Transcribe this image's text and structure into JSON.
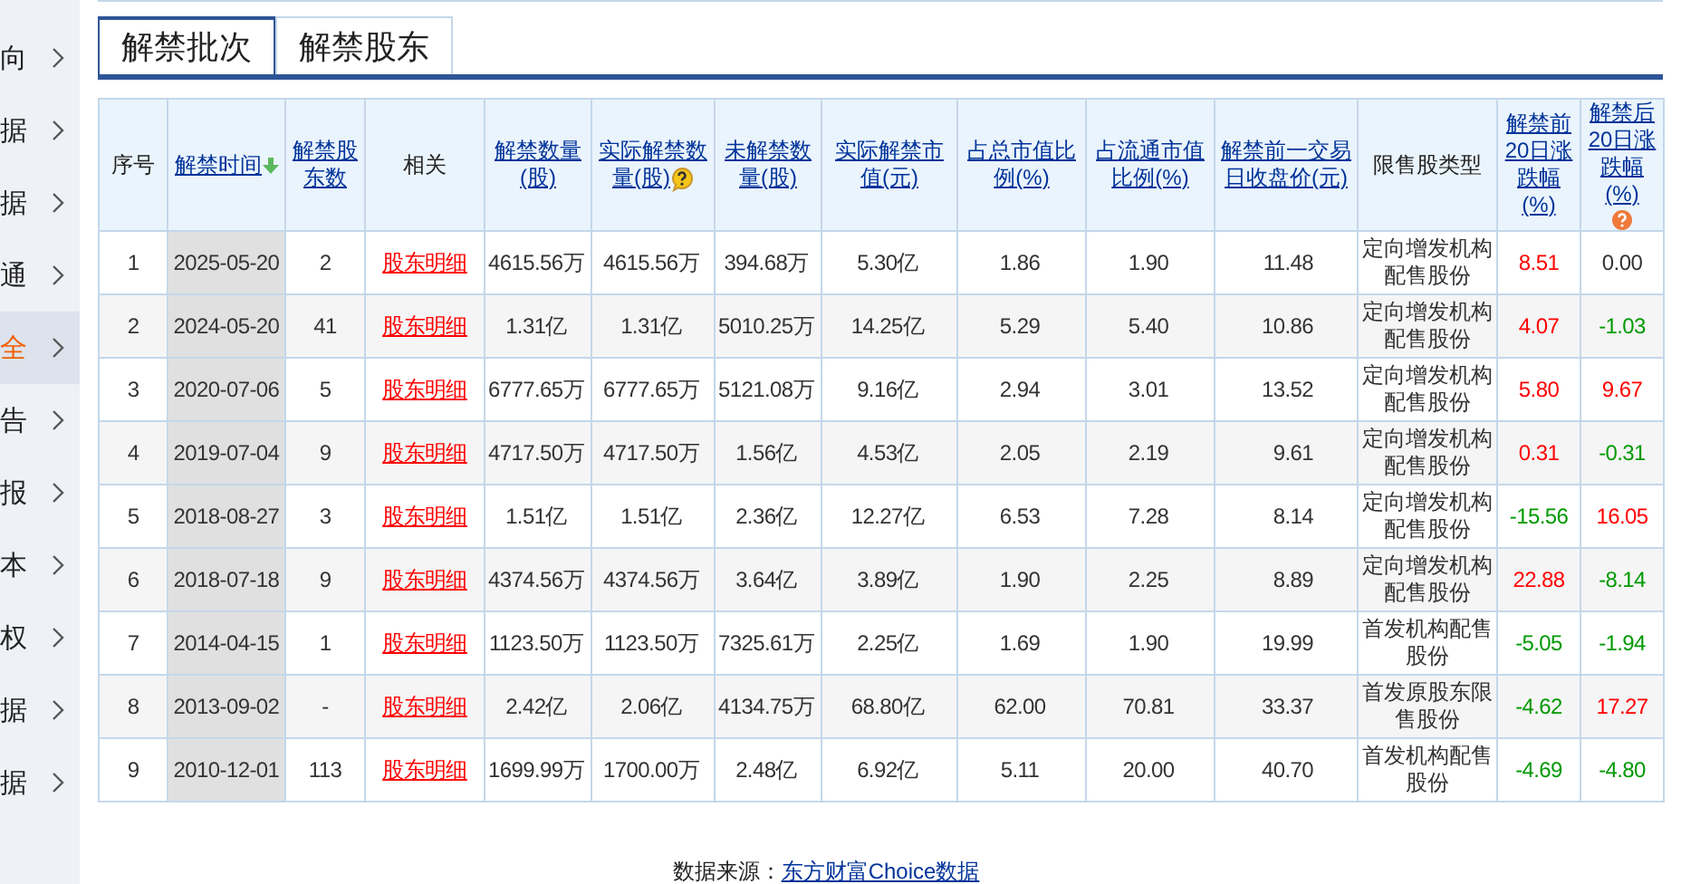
{
  "sidebar": {
    "items": [
      {
        "label": "向",
        "selected": false
      },
      {
        "label": "据",
        "selected": false
      },
      {
        "label": "据",
        "selected": false
      },
      {
        "label": "通",
        "selected": false
      },
      {
        "label": "全",
        "selected": true
      },
      {
        "label": "告",
        "selected": false
      },
      {
        "label": "报",
        "selected": false
      },
      {
        "label": "本",
        "selected": false
      },
      {
        "label": "权",
        "selected": false
      },
      {
        "label": "据",
        "selected": false
      },
      {
        "label": "据",
        "selected": false
      }
    ]
  },
  "tabs": [
    {
      "label": "解禁批次",
      "selected": true
    },
    {
      "label": "解禁股东",
      "selected": false
    }
  ],
  "table": {
    "columns": [
      {
        "label": "序号",
        "kind": "plain"
      },
      {
        "label": "解禁时间",
        "kind": "sorted"
      },
      {
        "label": "解禁股东数",
        "kind": "link"
      },
      {
        "label": "相关",
        "kind": "plain"
      },
      {
        "label": "解禁数量(股)",
        "kind": "link"
      },
      {
        "label": "实际解禁数量(股)",
        "kind": "help"
      },
      {
        "label": "未解禁数量(股)",
        "kind": "link"
      },
      {
        "label": "实际解禁市值(元)",
        "kind": "link"
      },
      {
        "label": "占总市值比例(%)",
        "kind": "link"
      },
      {
        "label": "占流通市值比例(%)",
        "kind": "link"
      },
      {
        "label": "解禁前一交易日收盘价(元)",
        "kind": "link"
      },
      {
        "label": "限售股类型",
        "kind": "plain"
      },
      {
        "label": "解禁前20日涨跌幅(%)",
        "kind": "link"
      },
      {
        "label": "解禁后20日涨跌幅(%)",
        "kind": "note"
      }
    ],
    "rows": [
      {
        "cells": [
          "1",
          "2025-05-20",
          "2",
          "股东明细",
          "4615.56万",
          "4615.56万",
          "394.68万",
          "5.30亿",
          "1.86",
          "1.90",
          "11.48",
          "定向增发机构配售股份"
        ],
        "before": {
          "text": "8.51",
          "color": "#ff0000"
        },
        "after": {
          "text": "0.00",
          "color": "#333333"
        }
      },
      {
        "cells": [
          "2",
          "2024-05-20",
          "41",
          "股东明细",
          "1.31亿",
          "1.31亿",
          "5010.25万",
          "14.25亿",
          "5.29",
          "5.40",
          "10.86",
          "定向增发机构配售股份"
        ],
        "before": {
          "text": "4.07",
          "color": "#ff0000"
        },
        "after": {
          "text": "-1.03",
          "color": "#009900"
        }
      },
      {
        "cells": [
          "3",
          "2020-07-06",
          "5",
          "股东明细",
          "6777.65万",
          "6777.65万",
          "5121.08万",
          "9.16亿",
          "2.94",
          "3.01",
          "13.52",
          "定向增发机构配售股份"
        ],
        "before": {
          "text": "5.80",
          "color": "#ff0000"
        },
        "after": {
          "text": "9.67",
          "color": "#ff0000"
        }
      },
      {
        "cells": [
          "4",
          "2019-07-04",
          "9",
          "股东明细",
          "4717.50万",
          "4717.50万",
          "1.56亿",
          "4.53亿",
          "2.05",
          "2.19",
          "9.61",
          "定向增发机构配售股份"
        ],
        "before": {
          "text": "0.31",
          "color": "#ff0000"
        },
        "after": {
          "text": "-0.31",
          "color": "#009900"
        }
      },
      {
        "cells": [
          "5",
          "2018-08-27",
          "3",
          "股东明细",
          "1.51亿",
          "1.51亿",
          "2.36亿",
          "12.27亿",
          "6.53",
          "7.28",
          "8.14",
          "定向增发机构配售股份"
        ],
        "before": {
          "text": "-15.56",
          "color": "#009900"
        },
        "after": {
          "text": "16.05",
          "color": "#ff0000"
        }
      },
      {
        "cells": [
          "6",
          "2018-07-18",
          "9",
          "股东明细",
          "4374.56万",
          "4374.56万",
          "3.64亿",
          "3.89亿",
          "1.90",
          "2.25",
          "8.89",
          "定向增发机构配售股份"
        ],
        "before": {
          "text": "22.88",
          "color": "#ff0000"
        },
        "after": {
          "text": "-8.14",
          "color": "#009900"
        }
      },
      {
        "cells": [
          "7",
          "2014-04-15",
          "1",
          "股东明细",
          "1123.50万",
          "1123.50万",
          "7325.61万",
          "2.25亿",
          "1.69",
          "1.90",
          "19.99",
          "首发机构配售股份"
        ],
        "before": {
          "text": "-5.05",
          "color": "#009900"
        },
        "after": {
          "text": "-1.94",
          "color": "#009900"
        }
      },
      {
        "cells": [
          "8",
          "2013-09-02",
          "-",
          "股东明细",
          "2.42亿",
          "2.06亿",
          "4134.75万",
          "68.80亿",
          "62.00",
          "70.81",
          "33.37",
          "首发原股东限售股份"
        ],
        "before": {
          "text": "-4.62",
          "color": "#009900"
        },
        "after": {
          "text": "17.27",
          "color": "#ff0000"
        }
      },
      {
        "cells": [
          "9",
          "2010-12-01",
          "113",
          "股东明细",
          "1699.99万",
          "1700.00万",
          "2.48亿",
          "6.92亿",
          "5.11",
          "20.00",
          "40.70",
          "首发机构配售股份"
        ],
        "before": {
          "text": "-4.69",
          "color": "#009900"
        },
        "after": {
          "text": "-4.80",
          "color": "#009900"
        }
      }
    ]
  },
  "footer": {
    "label": "数据来源：",
    "link": "东方财富Choice数据"
  }
}
